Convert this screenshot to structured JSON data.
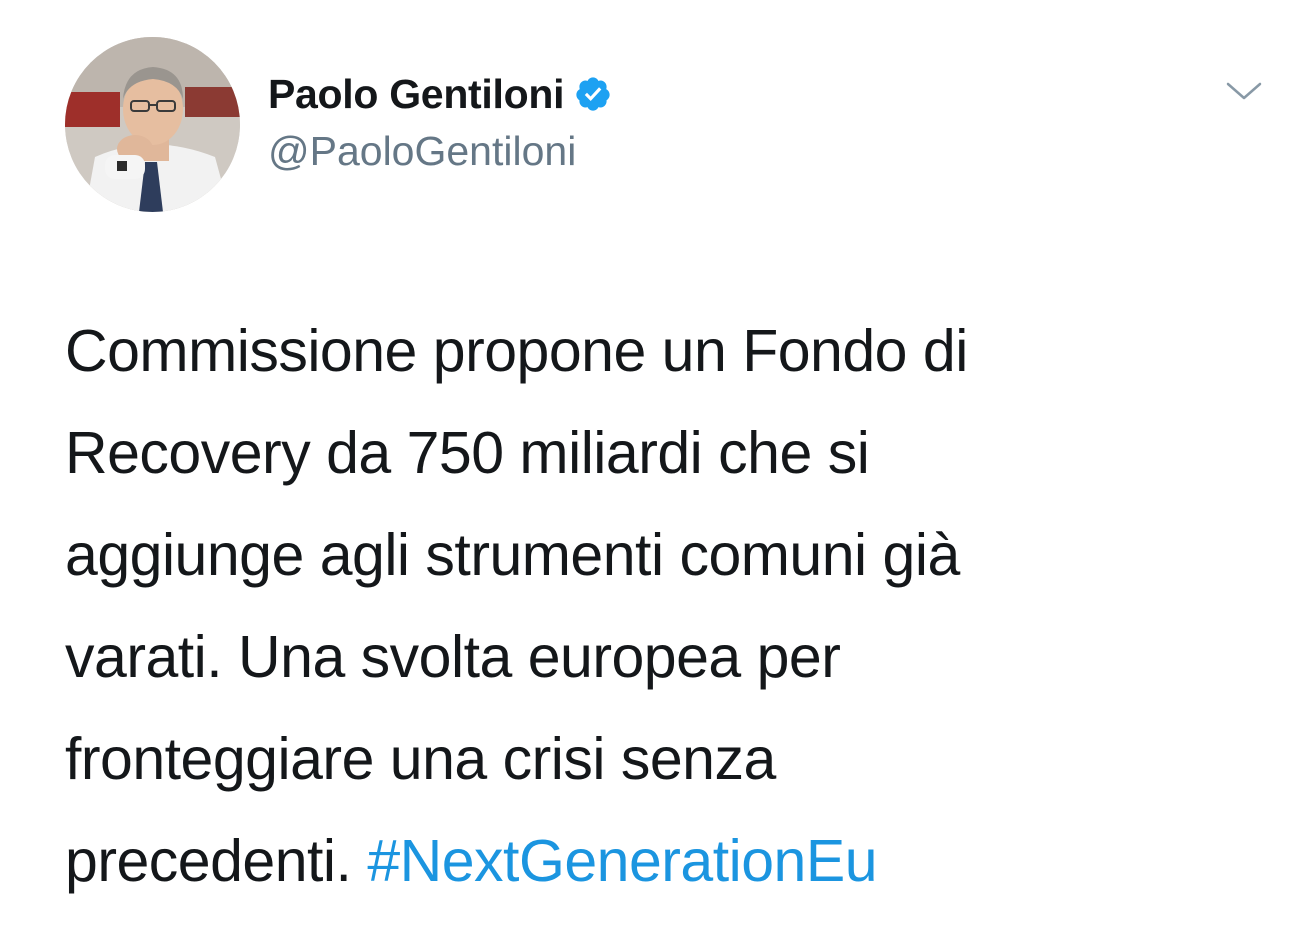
{
  "author": {
    "display_name": "Paolo Gentiloni",
    "handle": "@PaoloGentiloni",
    "verified": true,
    "avatar_icon": "profile-photo"
  },
  "menu": {
    "icon": "chevron-down-icon"
  },
  "tweet": {
    "lines": [
      "Commissione propone un Fondo di",
      "Recovery da 750 miliardi che si",
      "aggiunge agli strumenti comuni già",
      "varati. Una svolta europea per",
      "fronteggiare una crisi senza",
      "precedenti."
    ],
    "hashtag": "#NextGenerationEu"
  },
  "colors": {
    "text": "#14171a",
    "secondary": "#657786",
    "link": "#1b95e0",
    "verified_badge": "#1da1f2"
  }
}
